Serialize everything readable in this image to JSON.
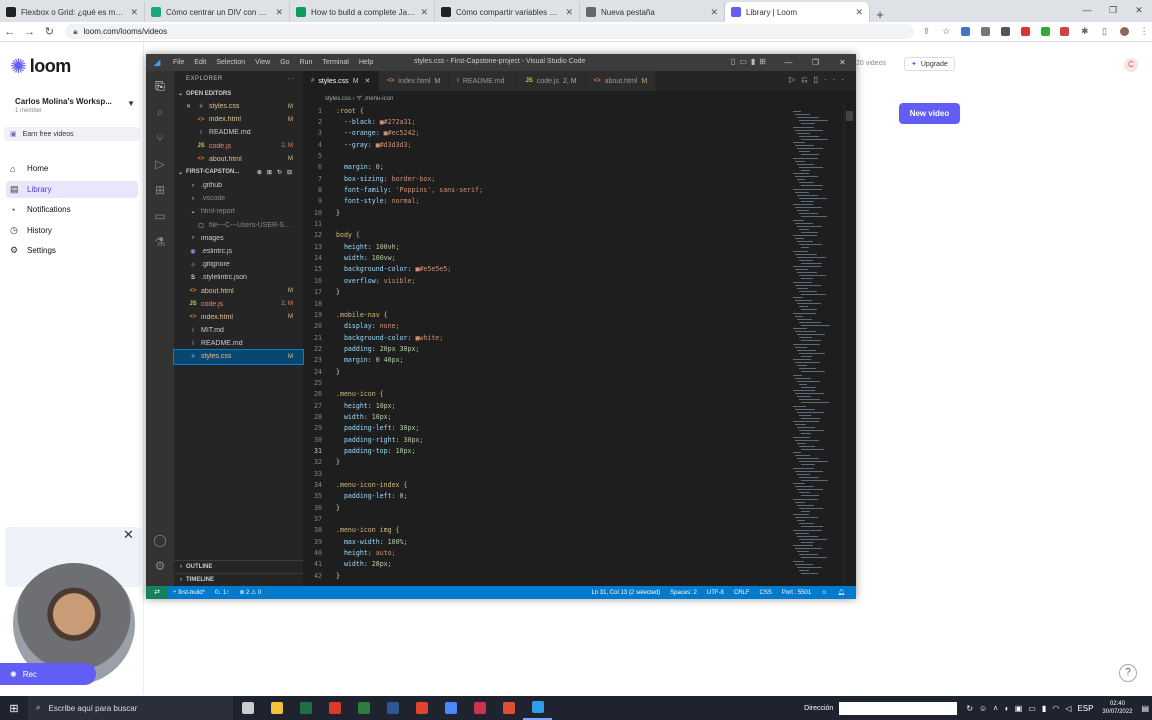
{
  "browser": {
    "tabs": [
      {
        "title": "Flexbox o Grid: ¿qué es más útil",
        "color": "#222"
      },
      {
        "title": "Cómo centrar un DIV con CSS",
        "color": "#19a974"
      },
      {
        "title": "How to build a complete JavaScr",
        "color": "#0a9d58"
      },
      {
        "title": "Cómo compartir variables en HT",
        "color": "#222"
      },
      {
        "title": "Nueva pestaña",
        "color": "#666"
      },
      {
        "title": "Library | Loom",
        "color": "#625df5",
        "active": true
      }
    ],
    "url": "loom.com/looms/videos"
  },
  "loom": {
    "brand": "loom",
    "workspace_name": "Carlos Molina's Worksp...",
    "workspace_members": "1 member",
    "earn": "Earn free videos",
    "nav": [
      {
        "label": "Home",
        "icon": "home-icon",
        "glyph": "⌂"
      },
      {
        "label": "Library",
        "icon": "library-icon",
        "glyph": "▤",
        "active": true
      },
      {
        "label": "Notifications",
        "icon": "bell-icon",
        "glyph": "◔"
      },
      {
        "label": "History",
        "icon": "clock-icon",
        "glyph": "◷"
      },
      {
        "label": "Settings",
        "icon": "gear-icon",
        "glyph": "⚙"
      }
    ],
    "videos_count": "20 videos",
    "upgrade": "Upgrade",
    "avatar_letter": "C",
    "new_video": "New video",
    "recorder_label": "Rec"
  },
  "vscode": {
    "menu": [
      "File",
      "Edit",
      "Selection",
      "View",
      "Go",
      "Run",
      "Terminal",
      "Help"
    ],
    "title": "styles.css - First-Capstone-project - Visual Studio Code",
    "explorer_header": "EXPLORER",
    "open_editors_label": "OPEN EDITORS",
    "open_editors": [
      {
        "name": "styles.css",
        "status": "M",
        "icon": "#",
        "icolor": "#519aba",
        "close": true
      },
      {
        "name": "index.html",
        "status": "M",
        "icon": "<>",
        "icolor": "#e37933"
      },
      {
        "name": "README.md",
        "status": "",
        "icon": "i",
        "icolor": "#519aba"
      },
      {
        "name": "code.js",
        "status": "2, M",
        "icon": "JS",
        "icolor": "#cbcb41",
        "err": true
      },
      {
        "name": "about.html",
        "status": "M",
        "icon": "<>",
        "icolor": "#e37933"
      }
    ],
    "project_label": "FIRST-CAPSTON...",
    "files": [
      {
        "name": ".github",
        "icon": "›",
        "icolor": "#ccc",
        "indent": 1,
        "dim": false
      },
      {
        "name": ".vscode",
        "icon": "›",
        "icolor": "#ccc",
        "indent": 1,
        "dim": true
      },
      {
        "name": "html-report",
        "icon": "⌄",
        "icolor": "#ccc",
        "indent": 1,
        "dim": true
      },
      {
        "name": "file---C---Users-USER-SOURC...",
        "icon": "▢",
        "icolor": "#888",
        "indent": 2,
        "dim": true
      },
      {
        "name": "images",
        "icon": "›",
        "icolor": "#ccc",
        "indent": 1,
        "dim": false
      },
      {
        "name": ".eslintrc.js",
        "icon": "◉",
        "icolor": "#a074c4",
        "indent": 1,
        "dim": false
      },
      {
        "name": ".gitignore",
        "icon": "◆",
        "icolor": "#41535b",
        "indent": 1,
        "dim": false
      },
      {
        "name": ".stylelintrc.json",
        "icon": "S",
        "icolor": "#ddd",
        "indent": 1,
        "dim": false
      },
      {
        "name": "about.html",
        "icon": "<>",
        "icolor": "#e37933",
        "indent": 1,
        "status": "M"
      },
      {
        "name": "code.js",
        "icon": "JS",
        "icolor": "#cbcb41",
        "indent": 1,
        "status": "2, M",
        "err": true
      },
      {
        "name": "index.html",
        "icon": "<>",
        "icolor": "#e37933",
        "indent": 1,
        "status": "M"
      },
      {
        "name": "MIT.md",
        "icon": "i",
        "icolor": "#519aba",
        "indent": 1
      },
      {
        "name": "README.md",
        "icon": "i",
        "icolor": "#519aba",
        "indent": 1
      },
      {
        "name": "styles.css",
        "icon": "#",
        "icolor": "#519aba",
        "indent": 1,
        "status": "M",
        "selected": true
      }
    ],
    "outline": "OUTLINE",
    "timeline": "TIMELINE",
    "editor_tabs": [
      {
        "name": "styles.css",
        "status": "M",
        "icon": "#",
        "icolor": "#519aba",
        "active": true
      },
      {
        "name": "index.html",
        "status": "M",
        "icon": "<>",
        "icolor": "#e37933"
      },
      {
        "name": "README.md",
        "status": "",
        "icon": "i",
        "icolor": "#519aba"
      },
      {
        "name": "code.js",
        "status": "2, M",
        "icon": "JS",
        "icolor": "#cbcb41"
      },
      {
        "name": "about.html",
        "status": "M",
        "icon": "<>",
        "icolor": "#e37933"
      }
    ],
    "breadcrumb": "styles.css  ›  🝖 .menu-icon",
    "code": [
      {
        "n": 1,
        "t": ":root {"
      },
      {
        "n": 2,
        "t": "  --black: ■#272a31;"
      },
      {
        "n": 3,
        "t": "  --orange: ■#ec5242;"
      },
      {
        "n": 4,
        "t": "  --gray: ■#d3d3d3;"
      },
      {
        "n": 5,
        "t": ""
      },
      {
        "n": 6,
        "t": "  margin: 0;"
      },
      {
        "n": 7,
        "t": "  box-sizing: border-box;"
      },
      {
        "n": 8,
        "t": "  font-family: 'Poppins', sans-serif;"
      },
      {
        "n": 9,
        "t": "  font-style: normal;"
      },
      {
        "n": 10,
        "t": "}"
      },
      {
        "n": 11,
        "t": ""
      },
      {
        "n": 12,
        "t": "body {"
      },
      {
        "n": 13,
        "t": "  height: 100vh;"
      },
      {
        "n": 14,
        "t": "  width: 100vw;"
      },
      {
        "n": 15,
        "t": "  background-color: ■#e5e5e5;"
      },
      {
        "n": 16,
        "t": "  overflow: visible;"
      },
      {
        "n": 17,
        "t": "}"
      },
      {
        "n": 18,
        "t": ""
      },
      {
        "n": 19,
        "t": ".mobile-nav {"
      },
      {
        "n": 20,
        "t": "  display: none;"
      },
      {
        "n": 21,
        "t": "  background-color: ■white;"
      },
      {
        "n": 22,
        "t": "  padding: 20px 30px;"
      },
      {
        "n": 23,
        "t": "  margin: 0 40px;"
      },
      {
        "n": 24,
        "t": "}"
      },
      {
        "n": 25,
        "t": ""
      },
      {
        "n": 26,
        "t": ".menu-icon {"
      },
      {
        "n": 27,
        "t": "  height: 10px;"
      },
      {
        "n": 28,
        "t": "  width: 10px;"
      },
      {
        "n": 29,
        "t": "  padding-left: 30px;"
      },
      {
        "n": 30,
        "t": "  padding-right: 30px;"
      },
      {
        "n": 31,
        "t": "  padding-top: 10px;"
      },
      {
        "n": 32,
        "t": "}"
      },
      {
        "n": 33,
        "t": ""
      },
      {
        "n": 34,
        "t": ".menu-icon-index {"
      },
      {
        "n": 35,
        "t": "  padding-left: 0;"
      },
      {
        "n": 36,
        "t": "}"
      },
      {
        "n": 37,
        "t": ""
      },
      {
        "n": 38,
        "t": ".menu-icon img {"
      },
      {
        "n": 39,
        "t": "  max-width: 100%;"
      },
      {
        "n": 40,
        "t": "  height: auto;"
      },
      {
        "n": 41,
        "t": "  width: 28px;"
      },
      {
        "n": 42,
        "t": "}"
      }
    ],
    "current_line": 31,
    "status": {
      "branch": "first-build*",
      "sync": "0↓ 1↑",
      "problems": "⊗ 2  ⚠ 0",
      "position": "Ln 31, Col 13 (2 selected)",
      "spaces": "Spaces: 2",
      "encoding": "UTF-8",
      "eol": "CRLF",
      "lang": "CSS",
      "port": "Port : 5501"
    }
  },
  "taskbar": {
    "search_placeholder": "Escribe aquí para buscar",
    "apps": [
      {
        "name": "task-view",
        "color": "#ccc"
      },
      {
        "name": "file-explorer",
        "color": "#f3c13a"
      },
      {
        "name": "excel",
        "color": "#1d7044"
      },
      {
        "name": "pdf-reader",
        "color": "#d93a2b"
      },
      {
        "name": "project",
        "color": "#2c7d3e"
      },
      {
        "name": "word",
        "color": "#2b5797"
      },
      {
        "name": "app-red",
        "color": "#e0452c"
      },
      {
        "name": "chrome",
        "color": "#4a8af4"
      },
      {
        "name": "app-pink",
        "color": "#c9344a"
      },
      {
        "name": "git",
        "color": "#e04f32"
      },
      {
        "name": "vscode",
        "color": "#2d9ee8",
        "active": true
      }
    ],
    "direccion": "Dirección",
    "lang": "ESP",
    "time": "02:40",
    "date": "30/07/2022"
  }
}
